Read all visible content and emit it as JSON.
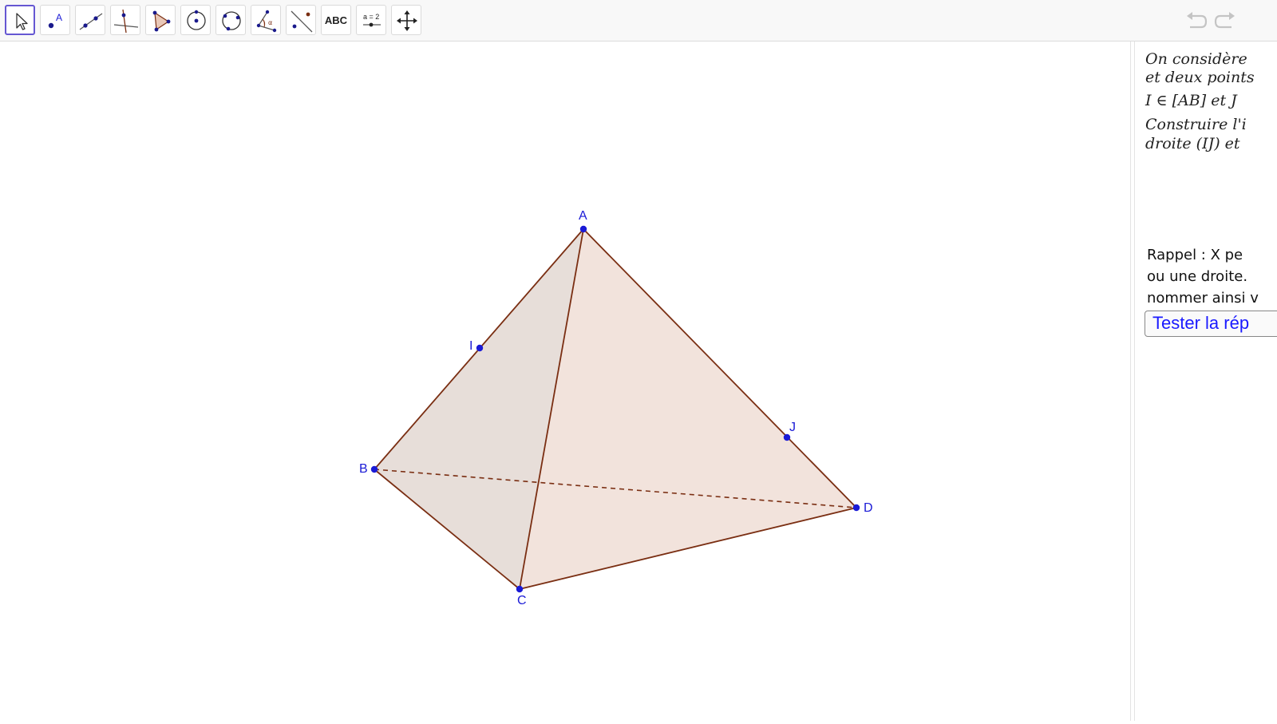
{
  "toolbar": {
    "tools": [
      {
        "name": "move",
        "icon": "cursor-arrow-icon"
      },
      {
        "name": "point",
        "icon": "point-icon",
        "label": "A"
      },
      {
        "name": "line",
        "icon": "line-icon"
      },
      {
        "name": "perpendicular",
        "icon": "perpendicular-line-icon"
      },
      {
        "name": "polygon",
        "icon": "polygon-icon"
      },
      {
        "name": "circle",
        "icon": "circle-center-point-icon"
      },
      {
        "name": "circle-three-points",
        "icon": "circle-three-points-icon"
      },
      {
        "name": "angle",
        "icon": "angle-icon",
        "label": "α"
      },
      {
        "name": "reflect",
        "icon": "reflect-about-line-icon"
      },
      {
        "name": "text",
        "icon": "text-icon",
        "label": "ABC"
      },
      {
        "name": "slider",
        "icon": "slider-icon",
        "label": "a = 2"
      },
      {
        "name": "move-graphics",
        "icon": "move-graphics-view-icon"
      }
    ],
    "undo_icon": "undo-icon",
    "redo_icon": "redo-icon"
  },
  "figure": {
    "points": {
      "A": "A",
      "B": "B",
      "C": "C",
      "D": "D",
      "I": "I",
      "J": "J"
    },
    "colors": {
      "edge": "#7a2e12",
      "face_fill": "#e9c8b8",
      "point": "#1a1ad6",
      "label": "#1a1ad6"
    }
  },
  "panel": {
    "statement": {
      "line1": "On considère",
      "line2": "et deux points",
      "line3": "I ∈ [AB] et J",
      "line4": "Construire l'i",
      "line5": "droite (IJ) et"
    },
    "rappel": {
      "line1": "Rappel  :  X pe",
      "line2": "ou une droite.",
      "line3": "nommer ainsi v"
    },
    "test_button": "Tester la rép"
  }
}
